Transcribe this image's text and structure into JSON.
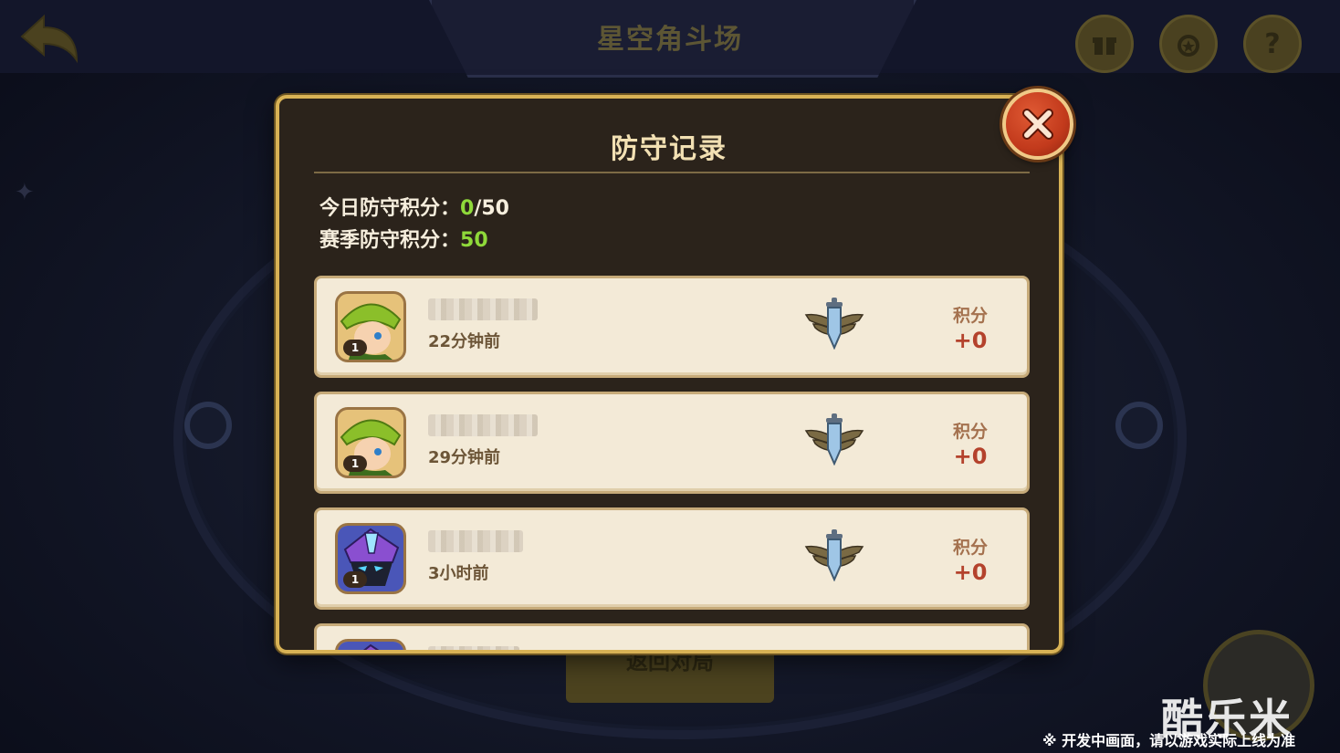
{
  "background": {
    "title": "星空角斗场",
    "return_label": "返回对局",
    "icons": [
      "back-arrow-icon",
      "gift-icon",
      "medal-icon",
      "help-icon"
    ]
  },
  "modal": {
    "title": "防守记录",
    "stats": {
      "today_label": "今日防守积分：",
      "today_value": "0",
      "today_total": "/50",
      "season_label": "赛季防守积分：",
      "season_value": "50"
    },
    "records": [
      {
        "hero": "green-hat-archer",
        "level": "1",
        "time": "22分钟前",
        "points_label": "积分",
        "points": "+0"
      },
      {
        "hero": "green-hat-archer",
        "level": "1",
        "time": "29分钟前",
        "points_label": "积分",
        "points": "+0"
      },
      {
        "hero": "purple-ninja",
        "level": "1",
        "time": "3小时前",
        "points_label": "积分",
        "points": "+0"
      }
    ]
  },
  "watermark": "酷乐米",
  "footer_note": "※ 开发中画面，请以游戏实际上线为准",
  "colors": {
    "accent_gold": "#d8b255",
    "green_value": "#8fd93a",
    "points_red": "#b4422c",
    "close_red": "#c23a1c"
  }
}
